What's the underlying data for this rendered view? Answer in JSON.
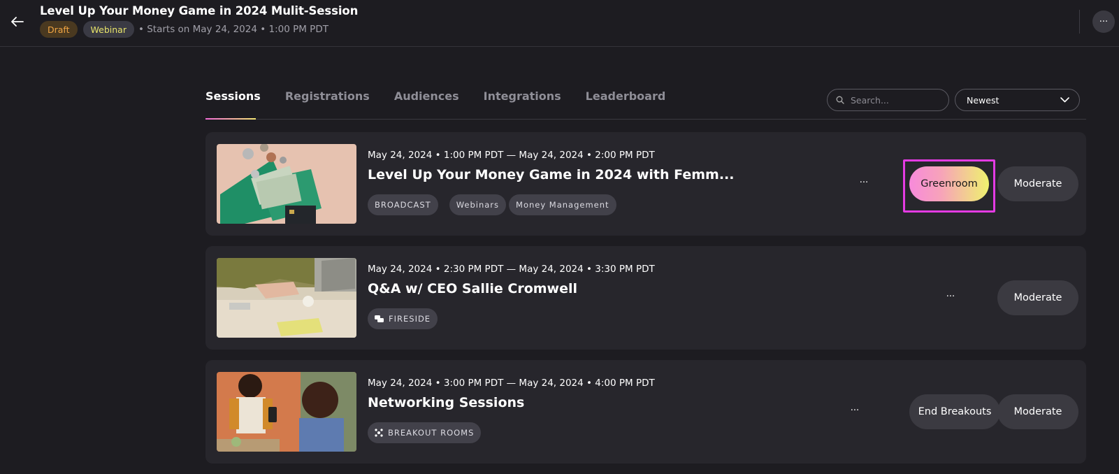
{
  "header": {
    "title": "Level Up Your Money Game in 2024 Mulit-Session",
    "badges": {
      "draft": "Draft",
      "webinar": "Webinar"
    },
    "starts": "• Starts on May 24, 2024 • 1:00 PM PDT",
    "more": "···"
  },
  "tabs": [
    "Sessions",
    "Registrations",
    "Audiences",
    "Integrations",
    "Leaderboard"
  ],
  "active_tab": "Sessions",
  "search": {
    "placeholder": "Search..."
  },
  "sort": {
    "value": "Newest"
  },
  "sessions": [
    {
      "datetime": "May 24, 2024 • 1:00 PM PDT — May 24, 2024 • 2:00 PM PDT",
      "title": "Level Up Your Money Game in 2024 with Femm...",
      "type": "BROADCAST",
      "tags": [
        "Webinars",
        "Money Management"
      ],
      "more": "···",
      "buttons": {
        "greenroom": "Greenroom",
        "moderate": "Moderate"
      }
    },
    {
      "datetime": "May 24, 2024 • 2:30 PM PDT — May 24, 2024 • 3:30 PM PDT",
      "title": "Q&A w/ CEO Sallie Cromwell",
      "type": "FIRESIDE",
      "type_icon": "chat-bubbles-icon",
      "more": "···",
      "buttons": {
        "moderate": "Moderate"
      }
    },
    {
      "datetime": "May 24, 2024 • 3:00 PM PDT — May 24, 2024 • 4:00 PM PDT",
      "title": "Networking Sessions",
      "type": "BREAKOUT ROOMS",
      "type_icon": "breakout-icon",
      "more": "···",
      "buttons": {
        "end_breakouts": "End Breakouts",
        "moderate": "Moderate"
      }
    }
  ],
  "colors": {
    "background": "#1d1c21",
    "card": "#27262c",
    "draft_text": "#f1a543",
    "webinar_text": "#e8e46a",
    "highlight_outline": "#e43be3"
  }
}
